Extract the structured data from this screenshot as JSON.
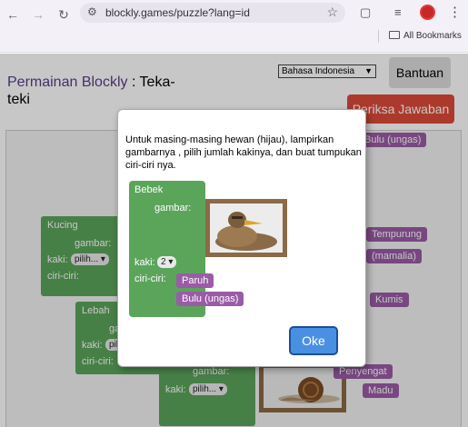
{
  "browser": {
    "url": "blockly.games/puzzle?lang=id",
    "bookmarks_label": "All Bookmarks"
  },
  "header": {
    "app_name": "Permainan Blockly",
    "separator": " : ",
    "puzzle_name": "Teka-teki",
    "language": "Bahasa Indonesia",
    "help_label": "Bantuan",
    "check_label": "Periksa Jawaban"
  },
  "workspace": {
    "kucing": {
      "name": "Kucing",
      "gambar": "gambar:",
      "kaki": "kaki:",
      "kaki_value": "pilih...",
      "ciri": "ciri-ciri:"
    },
    "lebah": {
      "name": "Lebah",
      "gambar": "gambar:",
      "kaki": "kaki:",
      "kaki_value": "pilih...",
      "ciri": "ciri-ciri:"
    },
    "siput": {
      "gambar": "gambar:",
      "kaki": "kaki:",
      "kaki_value": "pilih..."
    },
    "traits": [
      {
        "label": "Bulu (ungas)"
      },
      {
        "label": "Tempurung"
      },
      {
        "label": "(mamalia)"
      },
      {
        "label": "Kumis"
      },
      {
        "label": "Penyengat"
      },
      {
        "label": "Madu"
      }
    ]
  },
  "dialog": {
    "message": "Untuk masing-masing hewan (hijau), lampirkan gambarnya , pilih jumlah kakinya, dan buat tumpukan ciri-ciri nya.",
    "example": {
      "name": "Bebek",
      "gambar": "gambar:",
      "kaki": "kaki:",
      "kaki_value": "2",
      "ciri": "ciri-ciri:",
      "trait1": "Paruh",
      "trait2": "Bulu (ungas)"
    },
    "ok_label": "Oke"
  },
  "colors": {
    "animal_block": "#5ba55b",
    "trait_block": "#9a5ca6",
    "check_button": "#dd4b39",
    "ok_button": "#4a90e2"
  }
}
